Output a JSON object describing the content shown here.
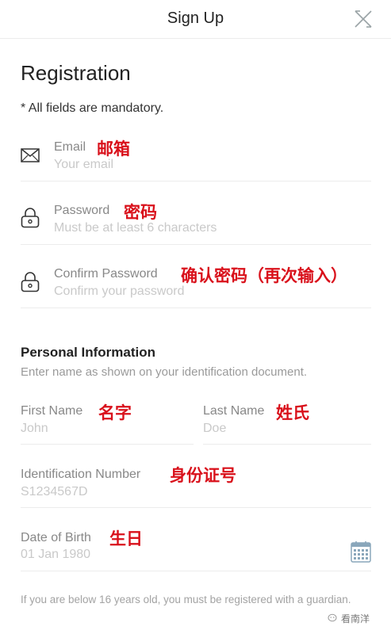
{
  "nav": {
    "title": "Sign Up",
    "close_icon": "close-icon"
  },
  "registration": {
    "title": "Registration",
    "mandatory_note": "* All fields are mandatory."
  },
  "fields": {
    "email": {
      "label": "Email",
      "placeholder": "Your email",
      "annotation": "邮箱",
      "icon": "mail-icon"
    },
    "password": {
      "label": "Password",
      "placeholder": "Must be at least 6 characters",
      "annotation": "密码",
      "icon": "lock-icon"
    },
    "confirm_password": {
      "label": "Confirm Password",
      "placeholder": "Confirm your password",
      "annotation": "确认密码（再次输入）",
      "icon": "lock-icon"
    }
  },
  "personal": {
    "title": "Personal Information",
    "subtitle": "Enter name as shown on your identification document.",
    "first_name": {
      "label": "First Name",
      "placeholder": "John",
      "annotation": "名字"
    },
    "last_name": {
      "label": "Last Name",
      "placeholder": "Doe",
      "annotation": "姓氏"
    },
    "id_number": {
      "label": "Identification Number",
      "placeholder": "S1234567D",
      "annotation": "身份证号"
    },
    "dob": {
      "label": "Date of Birth",
      "placeholder": "01 Jan 1980",
      "annotation": "生日",
      "icon": "calendar-icon"
    }
  },
  "footer_note": "If you are below 16 years old, you must be registered with a guardian.",
  "watermark": {
    "text": "看南洋",
    "icon": "wechat-icon"
  },
  "colors": {
    "annotation": "#d9111b",
    "label": "#888888",
    "placeholder": "#c9c9c9",
    "divider": "#ececec"
  }
}
